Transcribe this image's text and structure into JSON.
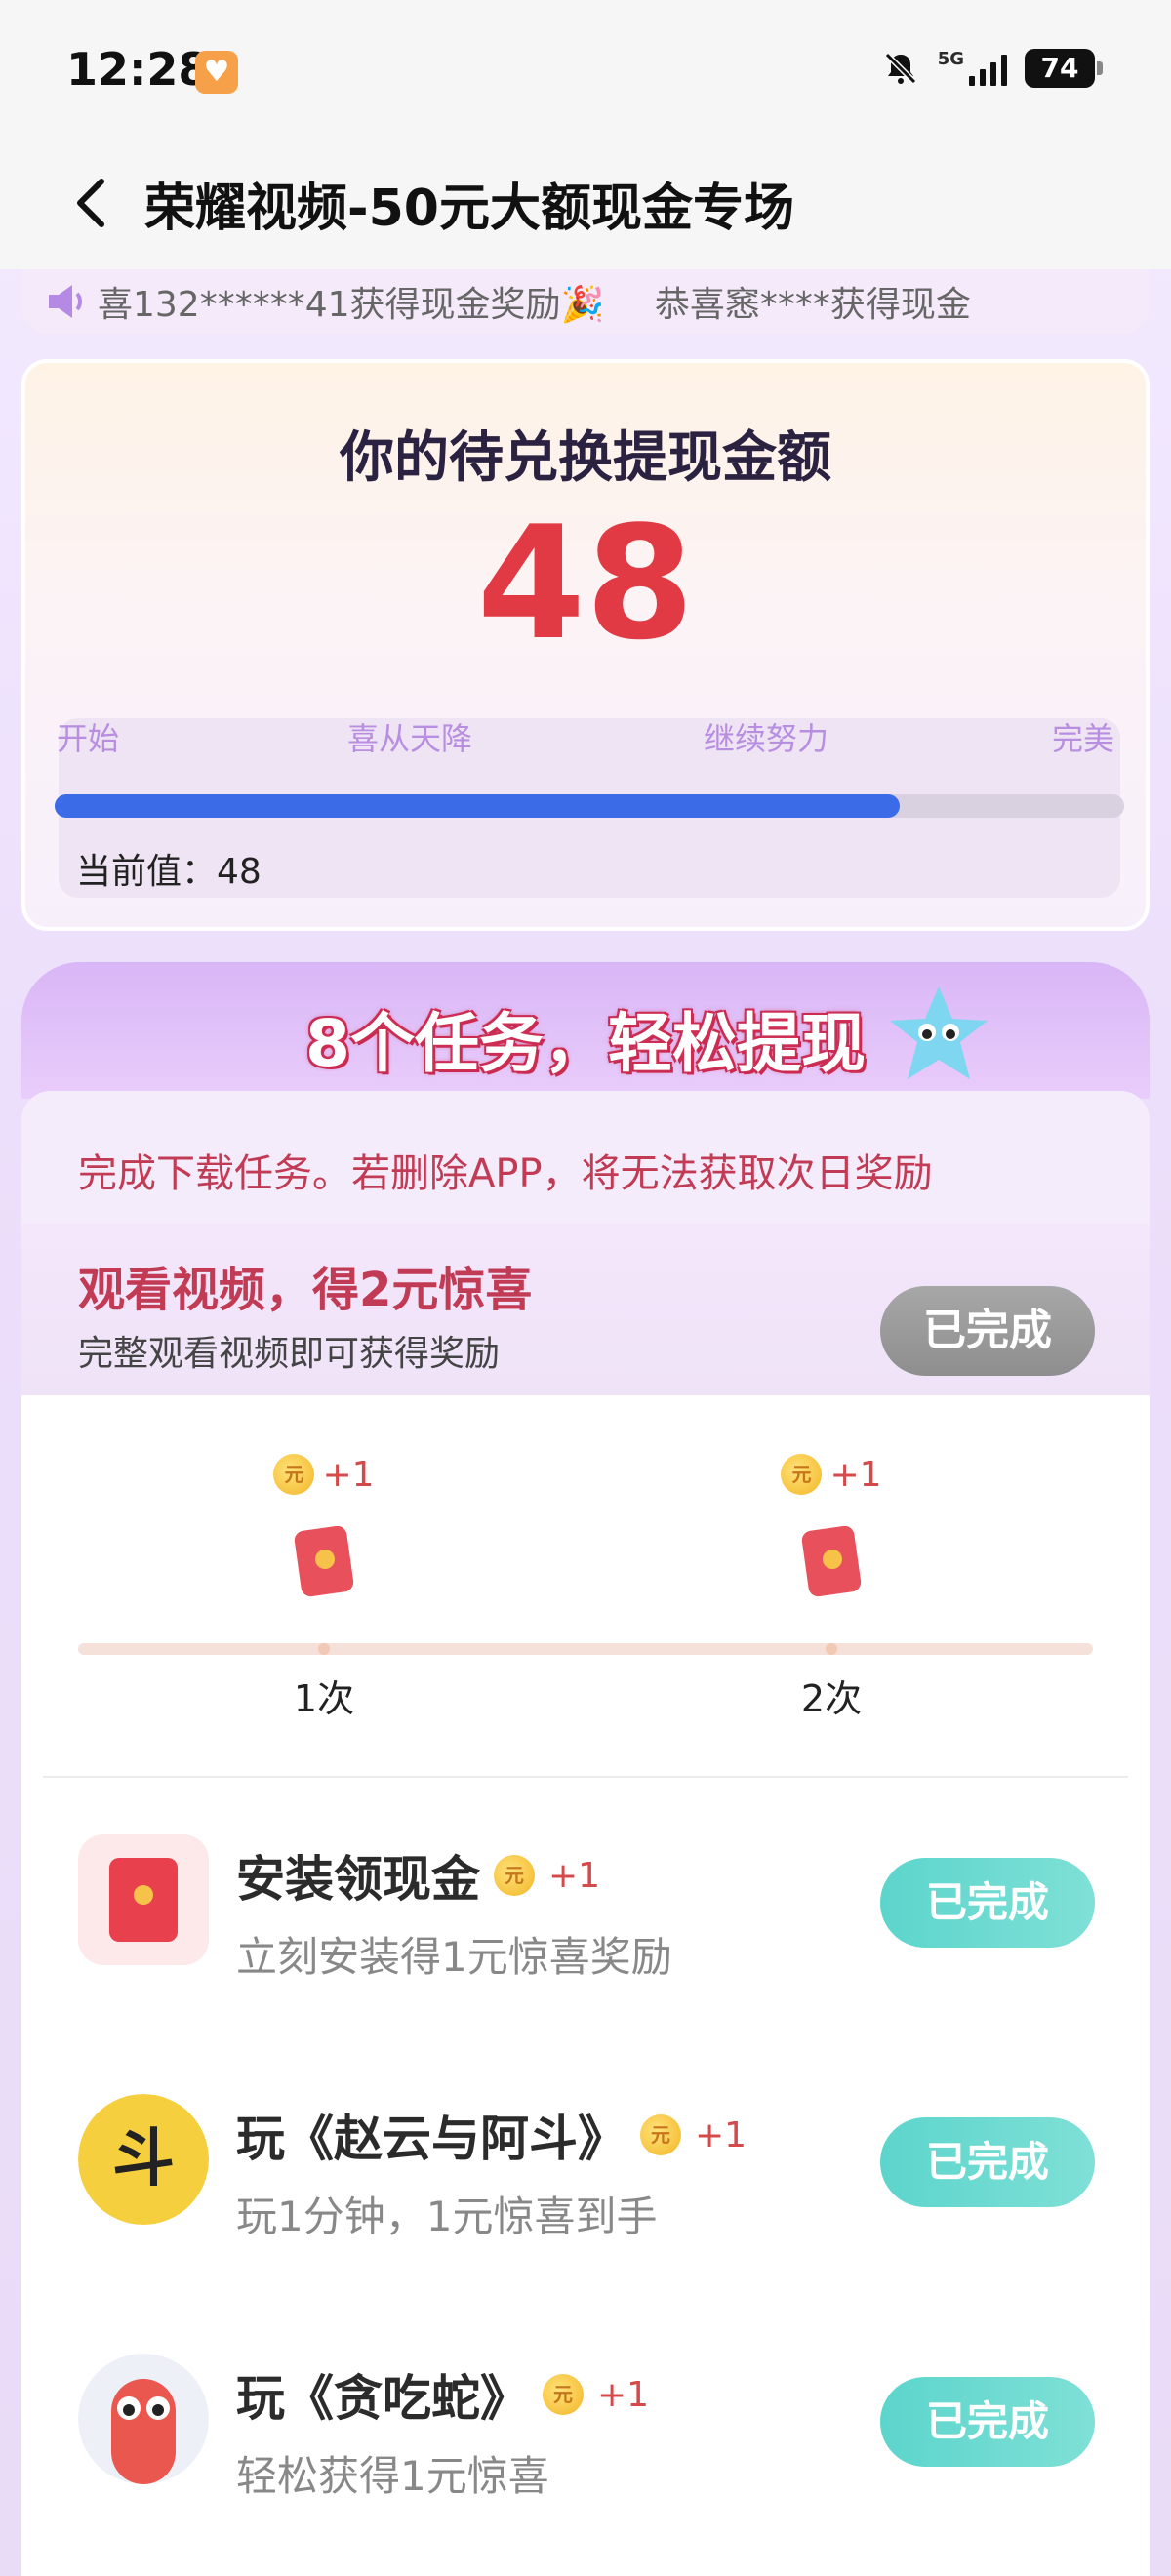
{
  "status_bar": {
    "time": "12:28",
    "network": "5G",
    "battery": "74"
  },
  "header": {
    "title": "荣耀视频-50元大额现金专场"
  },
  "marquee": {
    "items": [
      "喜132******41获得现金奖励🎉",
      "恭喜窸****获得现金"
    ]
  },
  "amount_card": {
    "title": "你的待兑换提现金额",
    "value": "48",
    "milestones": [
      "开始",
      "喜从天降",
      "继续努力",
      "完美"
    ],
    "progress": 0.79,
    "current_label": "当前值：48"
  },
  "tasks": {
    "heading": "8个任务，轻松提现",
    "notice": "完成下载任务。若删除APP，将无法获取次日奖励",
    "video": {
      "title": "观看视频，得2元惊喜",
      "subtitle": "完整观看视频即可获得奖励",
      "status": "已完成",
      "rewards": [
        {
          "plus": "+1",
          "label": "1次"
        },
        {
          "plus": "+1",
          "label": "2次"
        }
      ]
    },
    "items": [
      {
        "title": "安装领现金",
        "plus": "+1",
        "subtitle": "立刻安装得1元惊喜奖励",
        "status": "已完成"
      },
      {
        "title": "玩《赵云与阿斗》",
        "plus": "+1",
        "subtitle": "玩1分钟，1元惊喜到手",
        "status": "已完成"
      },
      {
        "title": "玩《贪吃蛇》",
        "plus": "+1",
        "subtitle": "轻松获得1元惊喜",
        "status": "已完成"
      }
    ]
  },
  "colors": {
    "accent_red": "#e23a44",
    "progress_blue": "#3b6be6",
    "done_teal": "#5cd5cc"
  }
}
